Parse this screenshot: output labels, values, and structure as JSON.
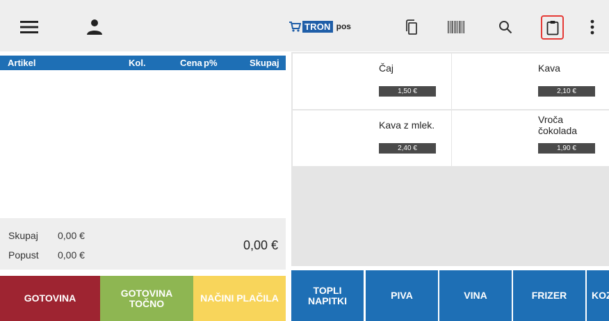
{
  "topbar": {
    "logo_tron": "TRON",
    "logo_pos": "pos",
    "icons": [
      "menu-icon",
      "user-icon",
      "copy-icon",
      "barcode-icon",
      "search-icon",
      "clipboard-icon",
      "more-vertical-icon"
    ],
    "highlight_color": "#e53935"
  },
  "list": {
    "headers": {
      "article": "Artikel",
      "qty": "Kol.",
      "price": "Cena",
      "discount_pct": "p%",
      "total": "Skupaj"
    },
    "rows": []
  },
  "totals": {
    "sum_label": "Skupaj",
    "sum_value": "0,00 €",
    "discount_label": "Popust",
    "discount_value": "0,00 €",
    "grand_total": "0,00 €"
  },
  "payment": {
    "cash": "GOTOVINA",
    "cash_exact": "GOTOVINA TOČNO",
    "methods": "NAČINI PLAČILA"
  },
  "products": [
    {
      "name": "Čaj",
      "price": "1,50 €"
    },
    {
      "name": "Kava",
      "price": "2,10 €"
    },
    {
      "name": "Kava z mlek.",
      "price": "2,40 €"
    },
    {
      "name": "Vroča čokolada",
      "price": "1,90 €"
    }
  ],
  "categories": [
    "TOPLI NAPITKI",
    "PIVA",
    "VINA",
    "FRIZER",
    "KOZ"
  ],
  "colors": {
    "header_blue": "#1e6fb5",
    "cash_red": "#9e2431",
    "exact_green": "#8eb652",
    "methods_yellow": "#f8d55b",
    "price_bg": "#4a4a4a"
  }
}
